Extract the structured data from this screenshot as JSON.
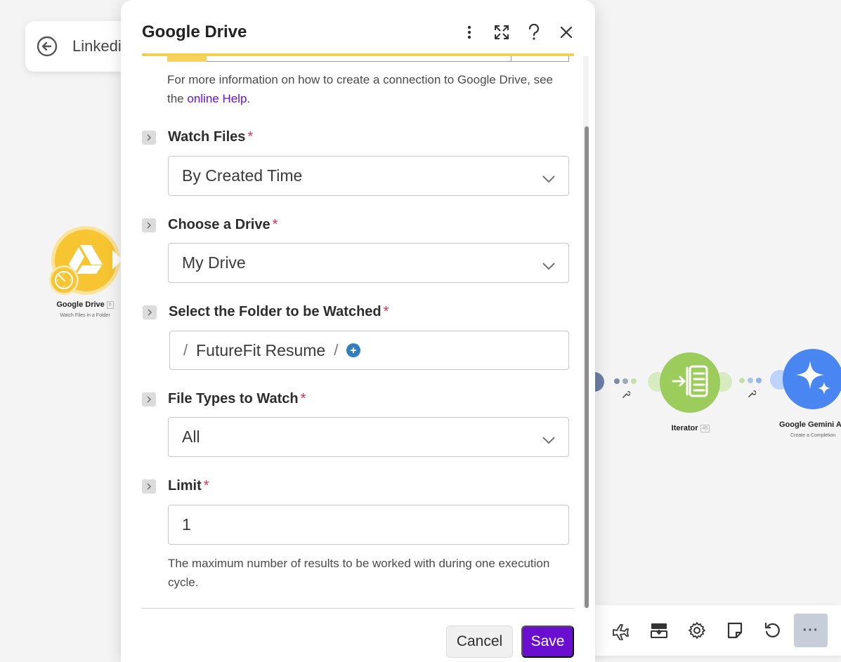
{
  "canvas": {
    "scenario_name": "Linkedi",
    "nodes": {
      "google_drive": {
        "title": "Google Drive",
        "badge": "6",
        "subtitle": "Watch Files in a Folder"
      },
      "iterator": {
        "title": "Iterator",
        "badge": "45"
      },
      "gemini": {
        "title": "Google Gemini A",
        "subtitle": "Create a Completion"
      }
    },
    "toolbar": {
      "more_label": "···"
    }
  },
  "dialog": {
    "title": "Google Drive",
    "connection_help": {
      "text_before": "For more information on how to create a connection to Google Drive, see the ",
      "link_text": "online Help",
      "text_after": "."
    },
    "fields": {
      "watch_files": {
        "label": "Watch Files",
        "required": "*",
        "value": "By Created Time"
      },
      "drive": {
        "label": "Choose a Drive",
        "required": "*",
        "value": "My Drive"
      },
      "folder": {
        "label": "Select the Folder to be Watched",
        "required": "*",
        "path_segment": "FutureFit Resume",
        "separator": "/"
      },
      "file_types": {
        "label": "File Types to Watch",
        "required": "*",
        "value": "All"
      },
      "limit": {
        "label": "Limit",
        "required": "*",
        "value": "1",
        "hint": "The maximum number of results to be worked with during one execution cycle."
      }
    },
    "buttons": {
      "cancel": "Cancel",
      "save": "Save"
    }
  },
  "colors": {
    "accent": "#6a0fcf",
    "drive_yellow": "#f7c531",
    "iterator_green": "#9bcc5c",
    "gemini_blue": "#4a86f2",
    "required_red": "#d9344e"
  }
}
